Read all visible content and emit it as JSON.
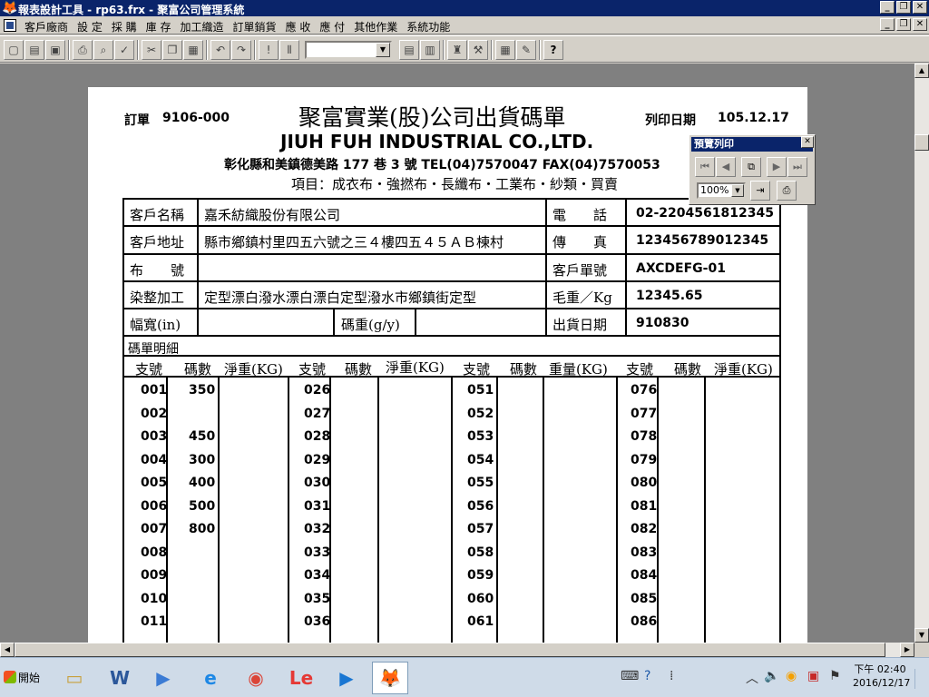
{
  "window": {
    "title": "報表設計工具 - rp63.frx - 聚富公司管理系統",
    "buttons": [
      "_",
      "❐",
      "✕"
    ]
  },
  "menu": {
    "items": [
      "客戶廠商",
      "設 定",
      "採 購",
      "庫 存",
      "加工織造",
      "訂單銷貨",
      "應 收",
      "應 付",
      "其他作業",
      "系統功能"
    ]
  },
  "report": {
    "order_label": "訂單",
    "order_no": "9106-000",
    "title_zh": "聚富實業(股)公司出貨碼單",
    "print_date_label": "列印日期",
    "print_date": "105.12.17",
    "title_en": "JIUH FUH INDUSTRIAL CO.,LTD.",
    "address_line": "彰化縣和美鎮德美路 177 巷 3 號  TEL(04)7570047  FAX(04)7570053",
    "items_line": "項目：成衣布・強撚布・長纖布・工業布・紗類・買賣",
    "fields": {
      "customer_name_label": "客戶名稱",
      "customer_name": "嘉禾紡織股份有限公司",
      "phone_label": "電　　話",
      "phone": "02-2204561812345",
      "customer_address_label": "客戶地址",
      "customer_address": "縣市鄉鎮村里四五六號之三４樓四五４５ＡＢ棟村",
      "fax_label": "傳　　真",
      "fax": "123456789012345",
      "cloth_no_label": "布　　號",
      "cloth_no": "",
      "customer_order_label": "客戶單號",
      "customer_order": "AXCDEFG-01",
      "dyeing_label": "染整加工",
      "dyeing": "定型漂白潑水漂白漂白定型潑水市鄉鎮街定型",
      "gross_weight_label": "毛重／Kg",
      "gross_weight": "12345.65",
      "width_label": "幅寬(in)",
      "width": "",
      "yard_weight_label": "碼重(g/y)",
      "yard_weight": "",
      "ship_date_label": "出貨日期",
      "ship_date": "910830"
    },
    "detail_label": "碼單明細",
    "col_headers": [
      [
        "支號",
        "碼數",
        "淨重(KG)"
      ],
      [
        "支號",
        "碼數",
        "淨重(KG)"
      ],
      [
        "支號",
        "碼數",
        "重量(KG)"
      ],
      [
        "支號",
        "碼數",
        "淨重(KG)"
      ]
    ],
    "rows": [
      [
        "001",
        "350",
        "026",
        "051",
        "076"
      ],
      [
        "002",
        "",
        "027",
        "052",
        "077"
      ],
      [
        "003",
        "450",
        "028",
        "053",
        "078"
      ],
      [
        "004",
        "300",
        "029",
        "054",
        "079"
      ],
      [
        "005",
        "400",
        "030",
        "055",
        "080"
      ],
      [
        "006",
        "500",
        "031",
        "056",
        "081"
      ],
      [
        "007",
        "800",
        "032",
        "057",
        "082"
      ],
      [
        "008",
        "",
        "033",
        "058",
        "083"
      ],
      [
        "009",
        "",
        "034",
        "059",
        "084"
      ],
      [
        "010",
        "",
        "035",
        "060",
        "085"
      ],
      [
        "011",
        "",
        "036",
        "061",
        "086"
      ]
    ]
  },
  "preview_toolbar": {
    "title": "預覽列印",
    "zoom": "100%"
  },
  "taskbar": {
    "start_label": "開始",
    "clock_time": "下午 02:40",
    "clock_date": "2016/12/17"
  },
  "colors": {
    "titlebar": "#0a246a",
    "client_bg": "#808080",
    "face": "#d4d0c8"
  }
}
